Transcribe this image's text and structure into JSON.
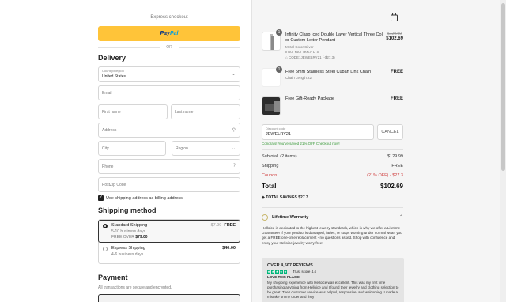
{
  "express": {
    "label": "Express checkout",
    "paypal_a": "Pay",
    "paypal_b": "Pal",
    "or": "OR"
  },
  "delivery": {
    "heading": "Delivery",
    "country_label": "Country/Region",
    "country_value": "United States",
    "email_ph": "Email",
    "first_ph": "First name",
    "last_ph": "Last name",
    "address_ph": "Address",
    "city_ph": "City",
    "region_ph": "Region",
    "phone_ph": "Phone",
    "zip_ph": "PostZip Code",
    "billing_label": "Use shipping address as billing address"
  },
  "shipping": {
    "heading": "Shipping method",
    "options": [
      {
        "name": "Standard Shipping",
        "days": "5-10 business days",
        "free_prefix": "FREE OVER",
        "free_amount": "$79.00",
        "old_price": "$7.99",
        "price": "FREE"
      },
      {
        "name": "Express Shipping",
        "days": "4-6 business days",
        "price": "$40.00"
      }
    ]
  },
  "payment": {
    "heading": "Payment",
    "sub": "All transactions are secure and encrypted."
  },
  "cart": {
    "items": [
      {
        "qty": "1",
        "title1": "Infinity Clasp Iced Double Layer Vertical Three Col",
        "title2": "or Custom Letter Pendant",
        "meta1": "Metal Color:Silver",
        "meta2": "Input Your Text:A D S",
        "meta3": "CODE: JEWELRY21 (-$27.3)",
        "old_price": "$129.99",
        "price": "$102.69"
      },
      {
        "qty": "1",
        "title1": "Free 5mm Stainless Steel Cuban Link Chain",
        "meta1": "Chain Length:22\"",
        "price": "FREE"
      },
      {
        "title1": "Free Gift-Ready Package",
        "price": "FREE"
      }
    ],
    "discount_label": "Discount code",
    "discount_value": "JEWELRY21",
    "cancel": "CANCEL",
    "congrats": "Congrats! You've saved 21% OFF Checkout now!",
    "subtotal_label": "Subtotal",
    "subtotal_items": "(2 items)",
    "subtotal_value": "$129.99",
    "shipping_label": "Shipping",
    "shipping_value": "FREE",
    "coupon_label": "Coupon",
    "coupon_value": "(21% OFF) - $27.3",
    "total_label": "Total",
    "total_value": "$102.69",
    "savings": "TOTAL SAVINGS $27.3"
  },
  "warranty": {
    "title": "Lifetime Warranty",
    "text": "Helloice is dedicated to the highest jewelry standards, which is why we offer a Lifetime Guarantee! If your product is damaged, fades, or stops working under normal wear, you get a FREE one-time replacement - no questions asked. Shop with confidence and enjoy your Helloice jewelry worry-free!"
  },
  "reviews": {
    "head": "OVER 4,507 REVIEWS",
    "trust": "Trust score 4.4",
    "love": "LOVE THIS PLACE!",
    "text": "My shopping experience with Helloice was excellent. This was my first time purchasing anything from Helloice and I found their jewelry and clothing selection to be great. Their customer service was helpful, responsive, and welcoming. I made a mistake on my order and they"
  },
  "colors": {
    "paypal": "#ffc439",
    "accent_green": "#3a9a3a",
    "coupon_red": "#d04040",
    "trustpilot": "#00b67a"
  },
  "icons": [
    "bag-icon",
    "search-icon",
    "help-icon",
    "chevron-down-icon",
    "chevron-up-icon",
    "tag-icon"
  ]
}
